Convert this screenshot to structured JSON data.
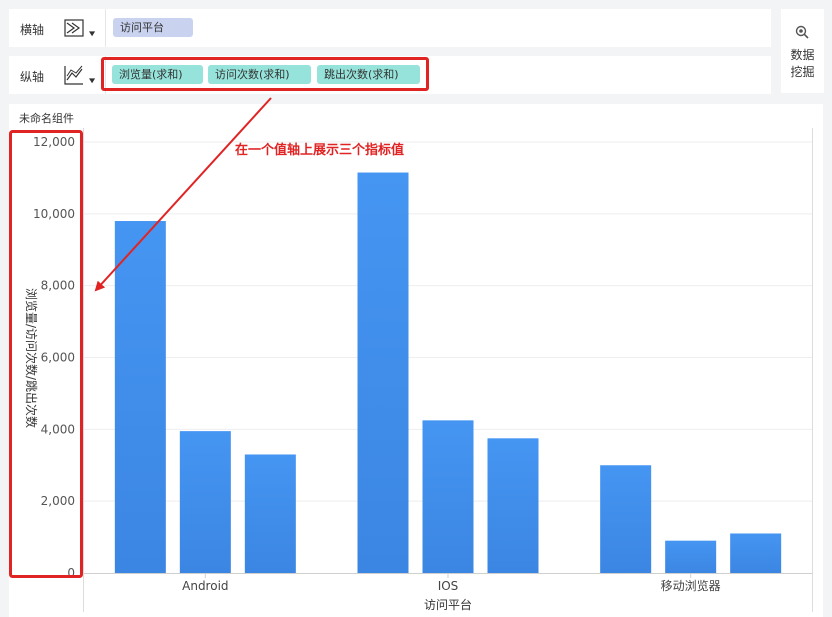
{
  "x_axis_row": {
    "label": "横轴",
    "icon": "dimension-axis-icon",
    "field_chip": "访问平台"
  },
  "y_axis_row": {
    "label": "纵轴",
    "icon": "line-chart-icon",
    "field_chips": [
      "浏览量(求和)",
      "访问次数(求和)",
      "跳出次数(求和)"
    ]
  },
  "mining_button": {
    "icon": "search-icon",
    "line1": "数据",
    "line2": "挖掘"
  },
  "component_title": "未命名组件",
  "annotation": {
    "text": "在一个值轴上展示三个指标值",
    "color": "#e02424"
  },
  "colors": {
    "bar": "#4191f0",
    "bar_bottom": "#3d8ae6",
    "dimension_chip": "#c9d3f0",
    "measure_chip": "#95e3da",
    "highlight": "#e02424"
  },
  "chart_data": {
    "type": "bar",
    "categories": [
      "Android",
      "IOS",
      "移动浏览器"
    ],
    "series": [
      {
        "name": "浏览量(求和)",
        "values": [
          9800,
          11150,
          3000
        ]
      },
      {
        "name": "访问次数(求和)",
        "values": [
          3950,
          4250,
          900
        ]
      },
      {
        "name": "跳出次数(求和)",
        "values": [
          3300,
          3750,
          1100
        ]
      }
    ],
    "ylim": [
      0,
      12000
    ],
    "yticks": [
      "12,000",
      "10,000",
      "8,000",
      "6,000",
      "4,000",
      "2,000",
      "0"
    ],
    "ytick_values": [
      12000,
      10000,
      8000,
      6000,
      4000,
      2000,
      0
    ],
    "xlabel": "访问平台",
    "ylabel": "浏览量/访问次数/跳出次数",
    "grid": true
  }
}
